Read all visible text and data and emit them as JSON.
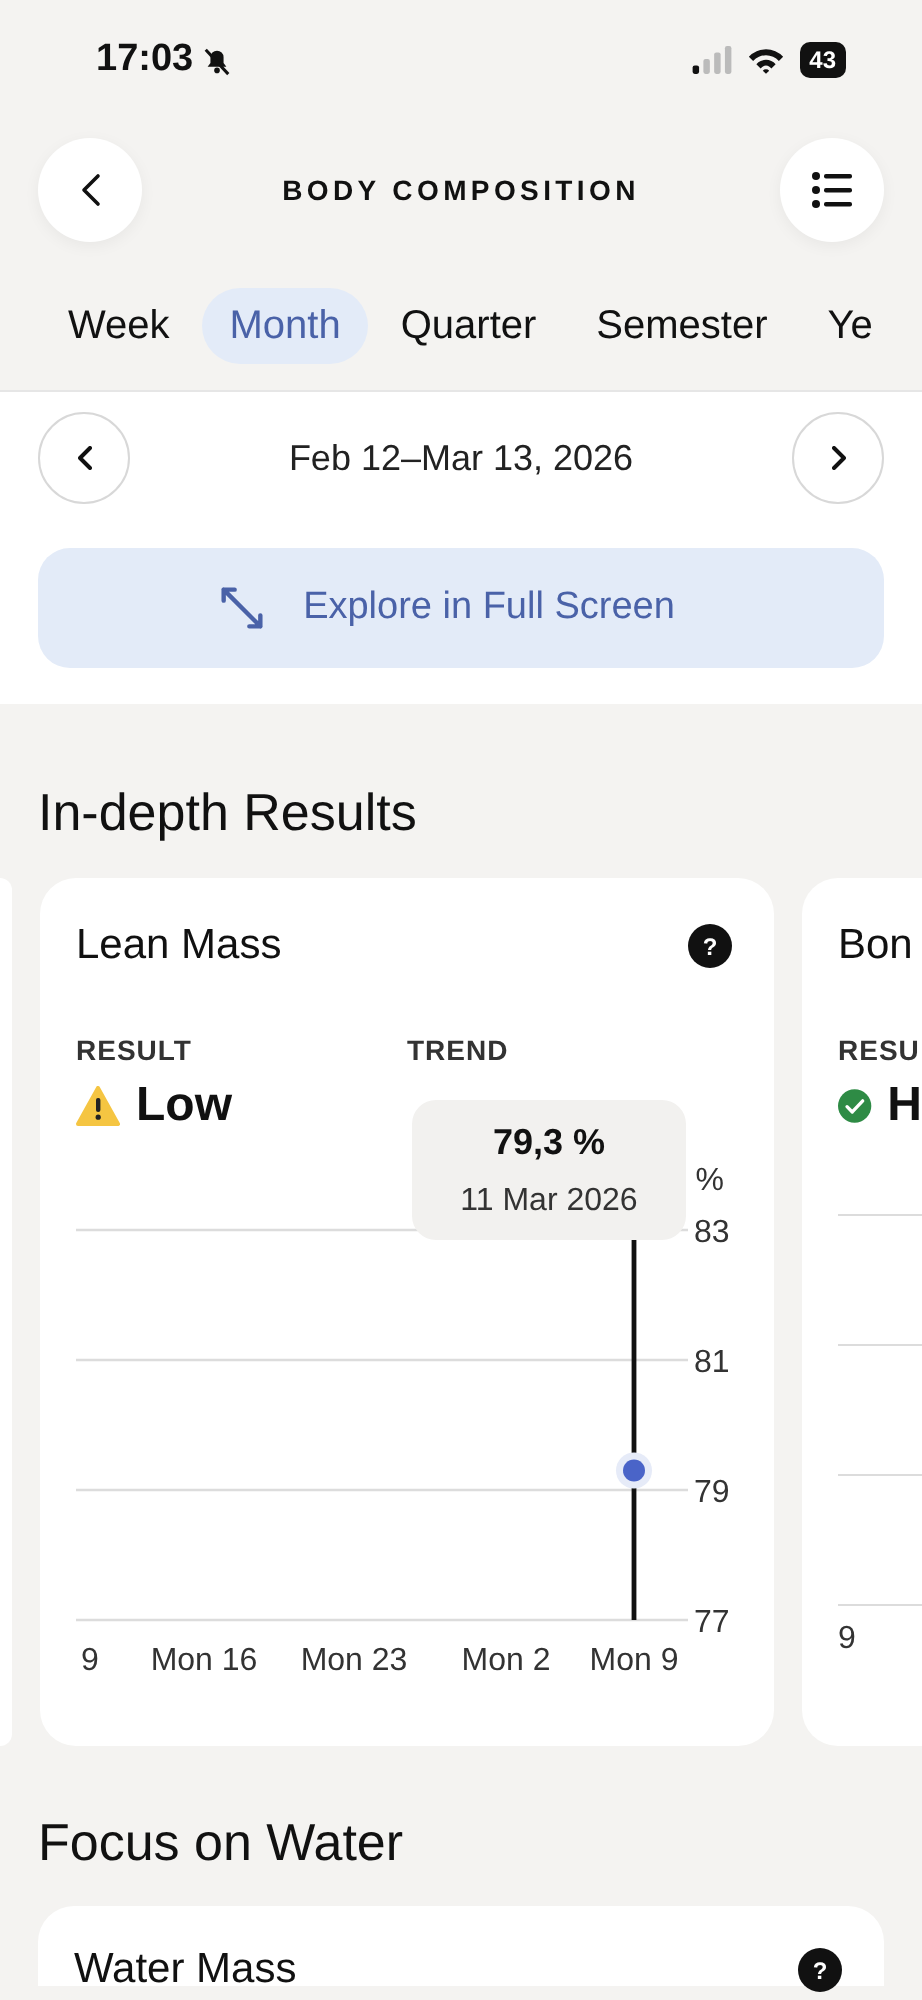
{
  "status_bar": {
    "time": "17:03",
    "battery": "43"
  },
  "header": {
    "title": "BODY COMPOSITION"
  },
  "period_tabs": [
    {
      "label": "Week",
      "selected": false
    },
    {
      "label": "Month",
      "selected": true
    },
    {
      "label": "Quarter",
      "selected": false
    },
    {
      "label": "Semester",
      "selected": false
    },
    {
      "label": "Ye",
      "selected": false
    }
  ],
  "date_range": {
    "label": "Feb 12–Mar 13, 2026"
  },
  "explore_button": {
    "label": "Explore in Full Screen"
  },
  "in_depth_results": {
    "title": "In-depth Results",
    "card": {
      "title": "Lean Mass",
      "help_label": "?",
      "result_label": "RESULT",
      "result": {
        "value": "Low",
        "kind": "warning"
      },
      "trend_label": "TREND",
      "unit": "%",
      "tooltip": {
        "value": "79,3 %",
        "date": "11 Mar 2026"
      },
      "chart_data": {
        "type": "scatter",
        "categories": [
          "9",
          "Mon 16",
          "Mon 23",
          "Mon 2",
          "Mon 9"
        ],
        "series": [
          {
            "color": "#4a64c8",
            "values": [
              null,
              null,
              null,
              null,
              79.3
            ]
          }
        ],
        "ylim": [
          77,
          83
        ],
        "yticks": [
          77,
          79,
          81,
          83
        ]
      }
    },
    "next_card": {
      "title": "Bon",
      "result_label": "RESU",
      "result": {
        "value": "H",
        "kind": "ok"
      },
      "x_label": "9"
    }
  },
  "focus_on_water": {
    "title": "Focus on Water",
    "card_title": "Water Mass",
    "help_label": "?"
  }
}
